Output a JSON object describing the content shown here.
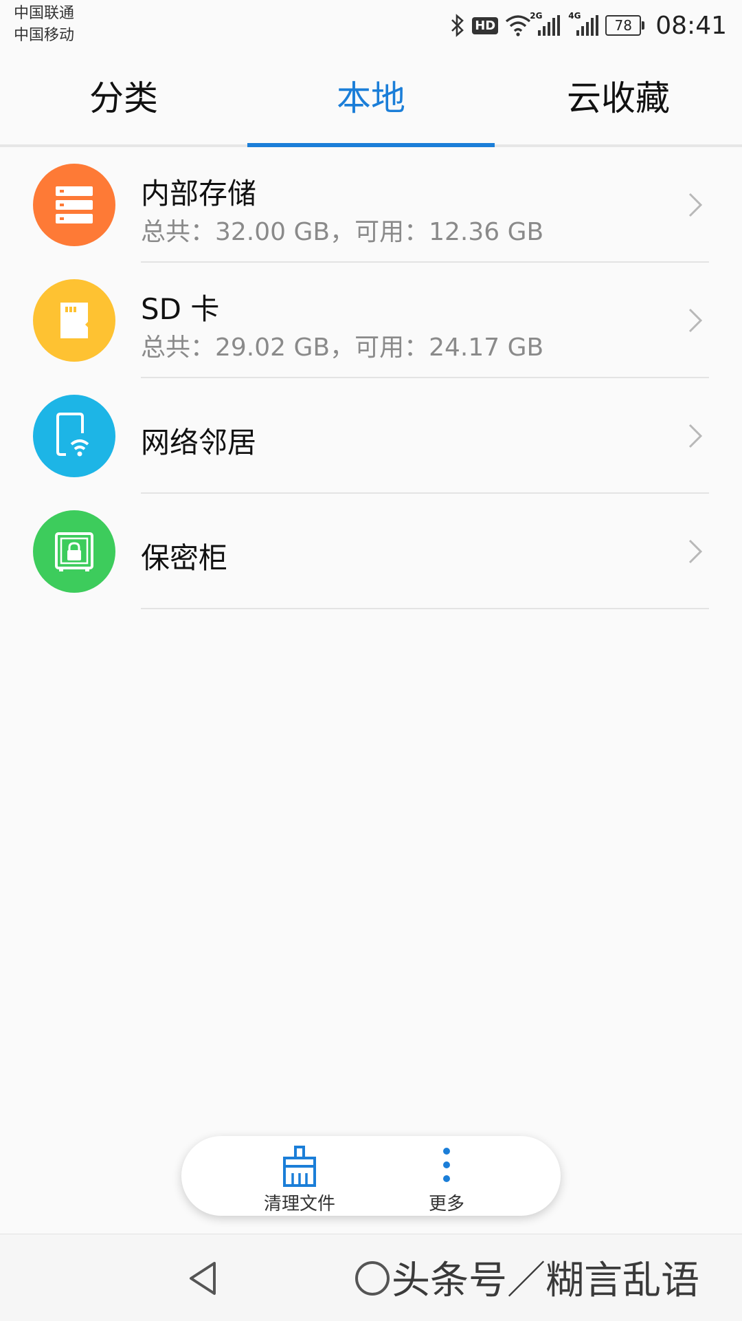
{
  "status_bar": {
    "carrier1": "中国联通",
    "carrier2": "中国移动",
    "hd": "HD",
    "net1": "2G",
    "net2": "4G",
    "battery": "78",
    "time": "08:41"
  },
  "tabs": [
    {
      "label": "分类",
      "active": false
    },
    {
      "label": "本地",
      "active": true
    },
    {
      "label": "云收藏",
      "active": false
    }
  ],
  "list": [
    {
      "title": "内部存储",
      "subtitle": "总共：32.00 GB，可用：12.36 GB",
      "icon": "storage-icon",
      "color": "#fe7a36"
    },
    {
      "title": "SD 卡",
      "subtitle": "总共：29.02 GB，可用：24.17 GB",
      "icon": "sd-card-icon",
      "color": "#fec232"
    },
    {
      "title": "网络邻居",
      "icon": "network-phone-icon",
      "color": "#1db5e6"
    },
    {
      "title": "保密柜",
      "icon": "safe-icon",
      "color": "#3dcc5c"
    }
  ],
  "bottom_bar": {
    "clean_label": "清理文件",
    "more_label": "更多"
  },
  "watermark": "头条号／糊言乱语",
  "colors": {
    "accent": "#1b7ed8"
  }
}
